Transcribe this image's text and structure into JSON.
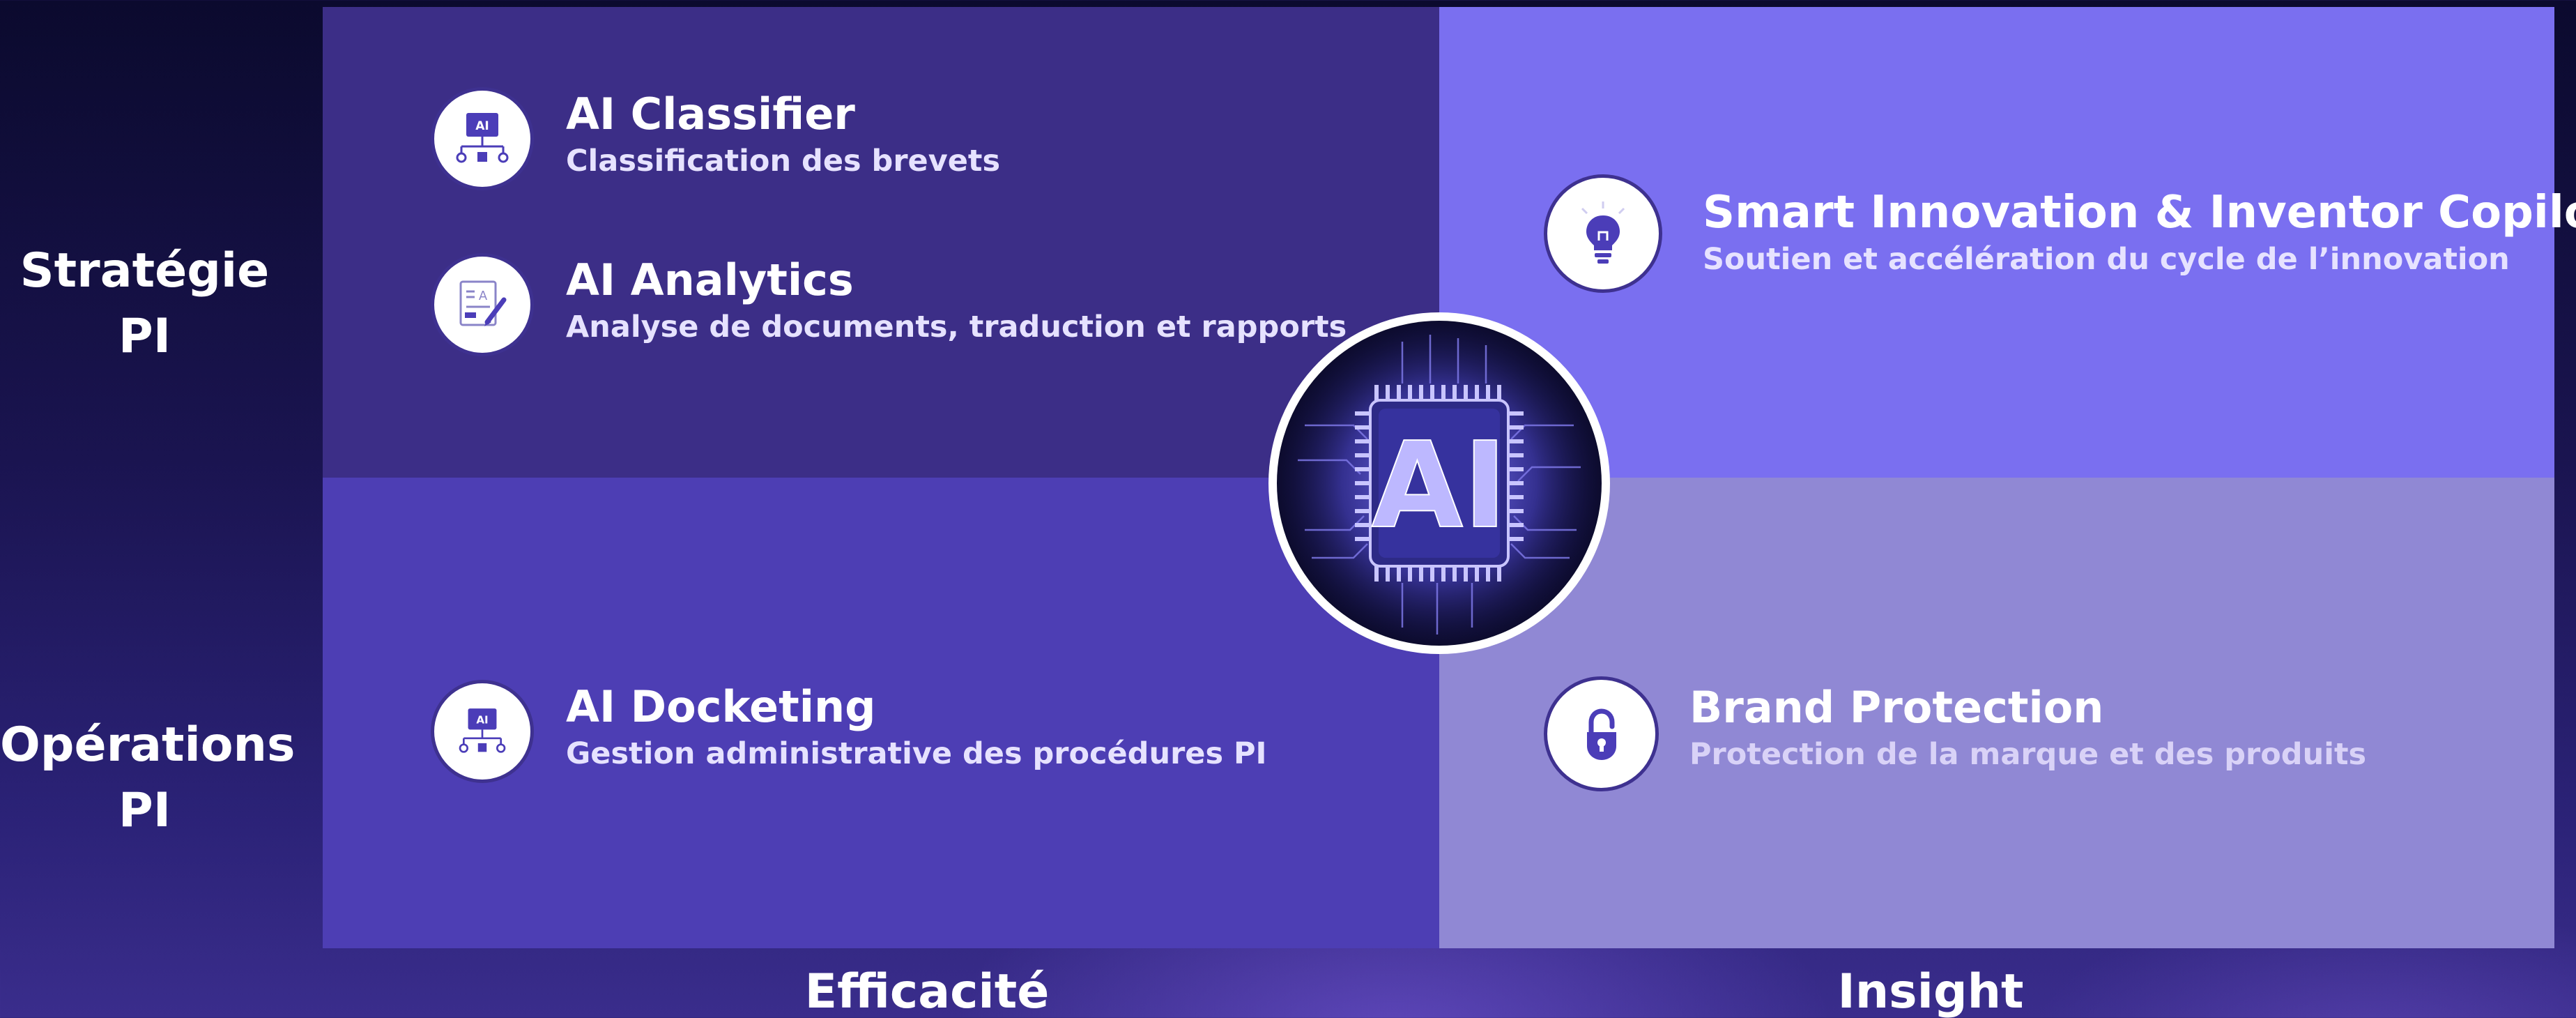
{
  "rows": [
    {
      "label_line1": "Stratégie",
      "label_line2": "PI"
    },
    {
      "label_line1": "Opérations",
      "label_line2": "PI"
    }
  ],
  "columns": [
    {
      "label": "Efficacité"
    },
    {
      "label": "Insight"
    }
  ],
  "center": {
    "label": "AI"
  },
  "quadrants": {
    "top_left": {
      "color": "#3c2e87",
      "items": [
        {
          "title": "AI Classifier",
          "subtitle": "Classification des brevets",
          "icon": "ai-hierarchy-icon"
        },
        {
          "title": "AI Analytics",
          "subtitle": "Analyse de documents, traduction et rapports",
          "icon": "document-pen-icon"
        }
      ]
    },
    "top_right": {
      "color": "#7a6ff0",
      "items": [
        {
          "title": "Smart Innovation & Inventor Copilot",
          "subtitle": "Soutien et accélération du cycle de l’innovation",
          "icon": "lightbulb-icon"
        }
      ]
    },
    "bottom_left": {
      "color": "#4d3eb4",
      "items": [
        {
          "title": "AI Docketing",
          "subtitle": "Gestion administrative des procédures PI",
          "icon": "ai-hierarchy-icon"
        }
      ]
    },
    "bottom_right": {
      "color": "#9088d4",
      "items": [
        {
          "title": "Brand Protection",
          "subtitle": "Protection de la marque et des produits",
          "icon": "padlock-icon"
        }
      ]
    }
  }
}
